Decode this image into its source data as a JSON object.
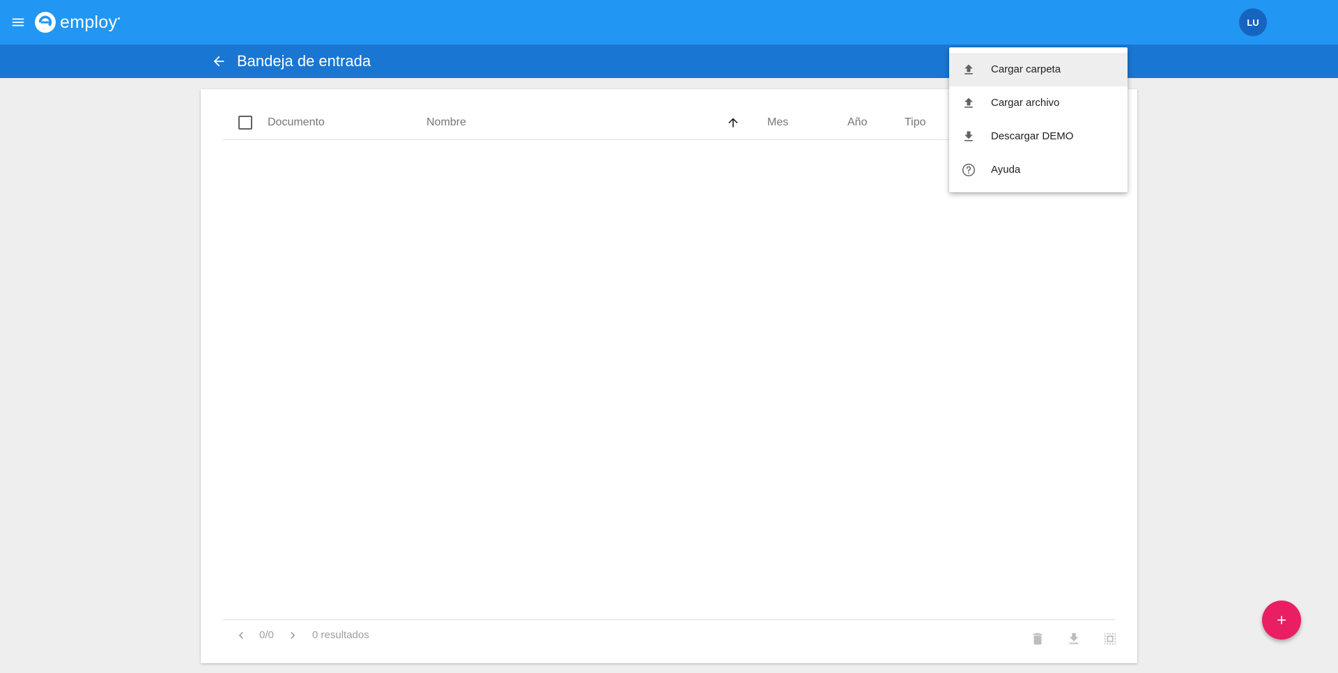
{
  "app": {
    "brand": "employ"
  },
  "user": {
    "initials": "LU"
  },
  "header": {
    "title": "Bandeja de entrada"
  },
  "table": {
    "columns": {
      "documento": "Documento",
      "nombre": "Nombre",
      "mes": "Mes",
      "anio": "Año",
      "tipo": "Tipo"
    },
    "sort": {
      "column": "nombre",
      "direction": "ascending"
    }
  },
  "pagination": {
    "page": "0/0",
    "results": "0 resultados"
  },
  "menu": {
    "items": [
      {
        "label": "Cargar carpeta",
        "icon": "upload-icon"
      },
      {
        "label": "Cargar archivo",
        "icon": "upload-icon"
      },
      {
        "label": "Descargar DEMO",
        "icon": "download-icon"
      },
      {
        "label": "Ayuda",
        "icon": "help-icon"
      }
    ]
  },
  "colors": {
    "topbar": "#2196f3",
    "subbar": "#1976d2",
    "avatar": "#1565c0",
    "fab": "#e91e63"
  },
  "icons": {
    "menu": "hamburger-icon",
    "back": "arrow-back-icon",
    "sort": "arrow-up-icon",
    "prev": "chevron-left-icon",
    "next": "chevron-right-icon",
    "delete": "trash-icon",
    "download": "download-icon",
    "select": "select-all-icon",
    "fab": "plus-icon"
  }
}
